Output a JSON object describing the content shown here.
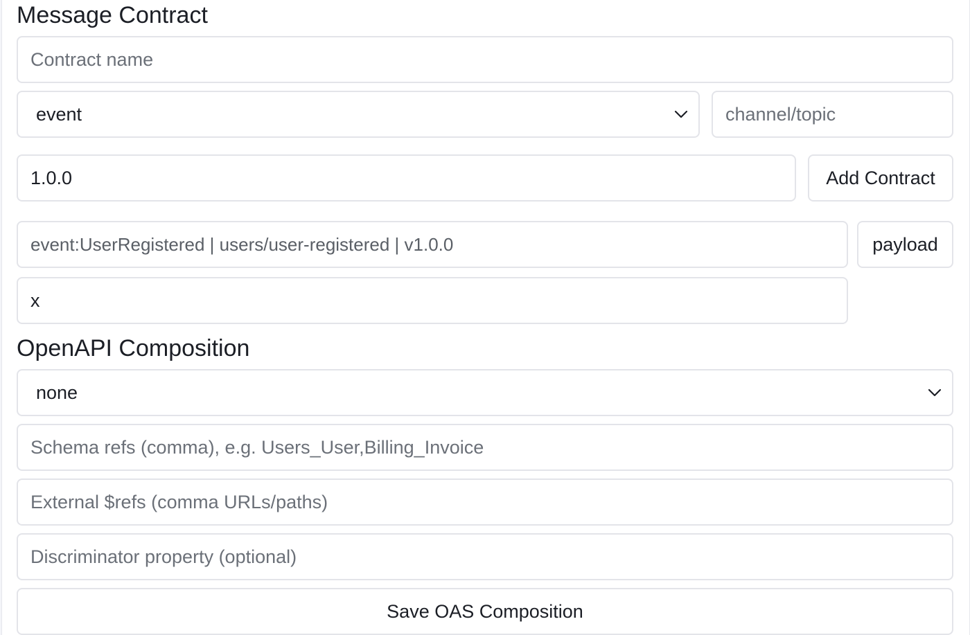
{
  "message_contract": {
    "title": "Message Contract",
    "name_placeholder": "Contract name",
    "kind_select": "event",
    "channel_placeholder": "channel/topic",
    "version_value": "1.0.0",
    "add_button": "Add Contract",
    "contract_item": "event:UserRegistered | users/user-registered | v1.0.0",
    "payload_button": "payload",
    "delete_field_value": "x"
  },
  "openapi_composition": {
    "title": "OpenAPI Composition",
    "mode_select": "none",
    "schema_refs_placeholder": "Schema refs (comma), e.g. Users_User,Billing_Invoice",
    "external_refs_placeholder": "External $refs (comma URLs/paths)",
    "discriminator_placeholder": "Discriminator property (optional)",
    "save_button": "Save OAS Composition"
  },
  "icons": {
    "select_arrow": "chevron-down-icon"
  }
}
